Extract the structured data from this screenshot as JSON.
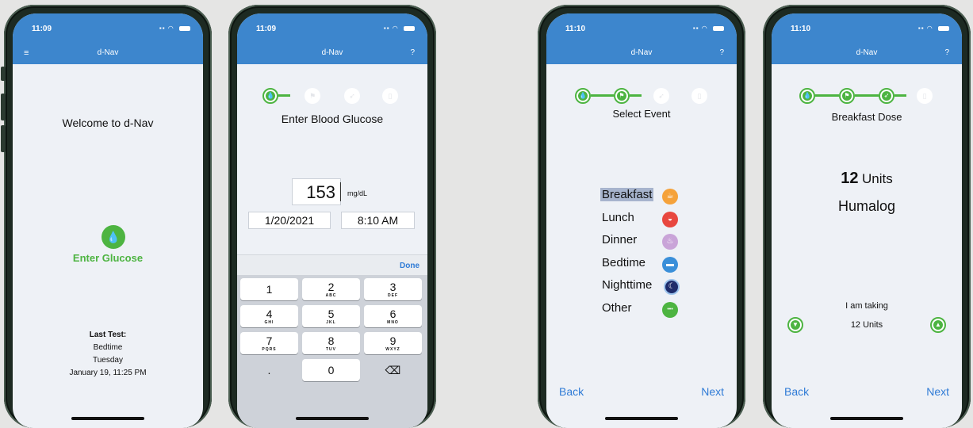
{
  "status": {
    "time1": "11:09",
    "time2": "11:09",
    "time3": "11:10",
    "time4": "11:10"
  },
  "app": {
    "title": "d-Nav",
    "menu_icon": "≡",
    "help_icon": "?"
  },
  "icons": {
    "step_drop": "💧",
    "step_flag": "⚑",
    "step_syringe": "➶",
    "step_bottle": "▯"
  },
  "screen1": {
    "welcome": "Welcome to d-Nav",
    "enter_glucose": "Enter Glucose",
    "last_test_label": "Last Test:",
    "last_test_event": "Bedtime",
    "last_test_day": "Tuesday",
    "last_test_datetime": "January 19, 11:25 PM"
  },
  "screen2": {
    "heading": "Enter Blood Glucose",
    "glucose_value": "153",
    "unit": "mg/dL",
    "date": "1/20/2021",
    "time": "8:10 AM",
    "done": "Done",
    "keys": [
      {
        "num": "1",
        "sub": ""
      },
      {
        "num": "2",
        "sub": "ABC"
      },
      {
        "num": "3",
        "sub": "DEF"
      },
      {
        "num": "4",
        "sub": "GHI"
      },
      {
        "num": "5",
        "sub": "JKL"
      },
      {
        "num": "6",
        "sub": "MNO"
      },
      {
        "num": "7",
        "sub": "PQRS"
      },
      {
        "num": "8",
        "sub": "TUV"
      },
      {
        "num": "9",
        "sub": "WXYZ"
      },
      {
        "num": ".",
        "sub": ""
      },
      {
        "num": "0",
        "sub": ""
      },
      {
        "num": "⌫",
        "sub": ""
      }
    ]
  },
  "screen3": {
    "heading": "Select Event",
    "events": [
      {
        "label": "Breakfast",
        "icon": "breakfast-icon",
        "glyph": "☕",
        "color": "#f5a23a",
        "selected": true
      },
      {
        "label": "Lunch",
        "icon": "lunch-icon",
        "glyph": "◒",
        "color": "#e8473f",
        "selected": false
      },
      {
        "label": "Dinner",
        "icon": "dinner-icon",
        "glyph": "♨",
        "color": "#c9a4d8",
        "selected": false
      },
      {
        "label": "Bedtime",
        "icon": "bedtime-icon",
        "glyph": "▬",
        "color": "#3a8fd9",
        "selected": false
      },
      {
        "label": "Nighttime",
        "icon": "nighttime-icon",
        "glyph": "☾",
        "color": "#1e2c6b",
        "selected": false
      },
      {
        "label": "Other",
        "icon": "other-icon",
        "glyph": "•••",
        "color": "#4db441",
        "selected": false
      }
    ],
    "back": "Back",
    "next": "Next"
  },
  "screen4": {
    "heading": "Breakfast Dose",
    "dose_value": "12",
    "dose_unit": "Units",
    "insulin": "Humalog",
    "taking_label": "I am taking",
    "taking_value": "12 Units",
    "back": "Back",
    "next": "Next"
  },
  "colors": {
    "header": "#3d86cd",
    "accent": "#4db441",
    "link": "#2f7bd6"
  }
}
